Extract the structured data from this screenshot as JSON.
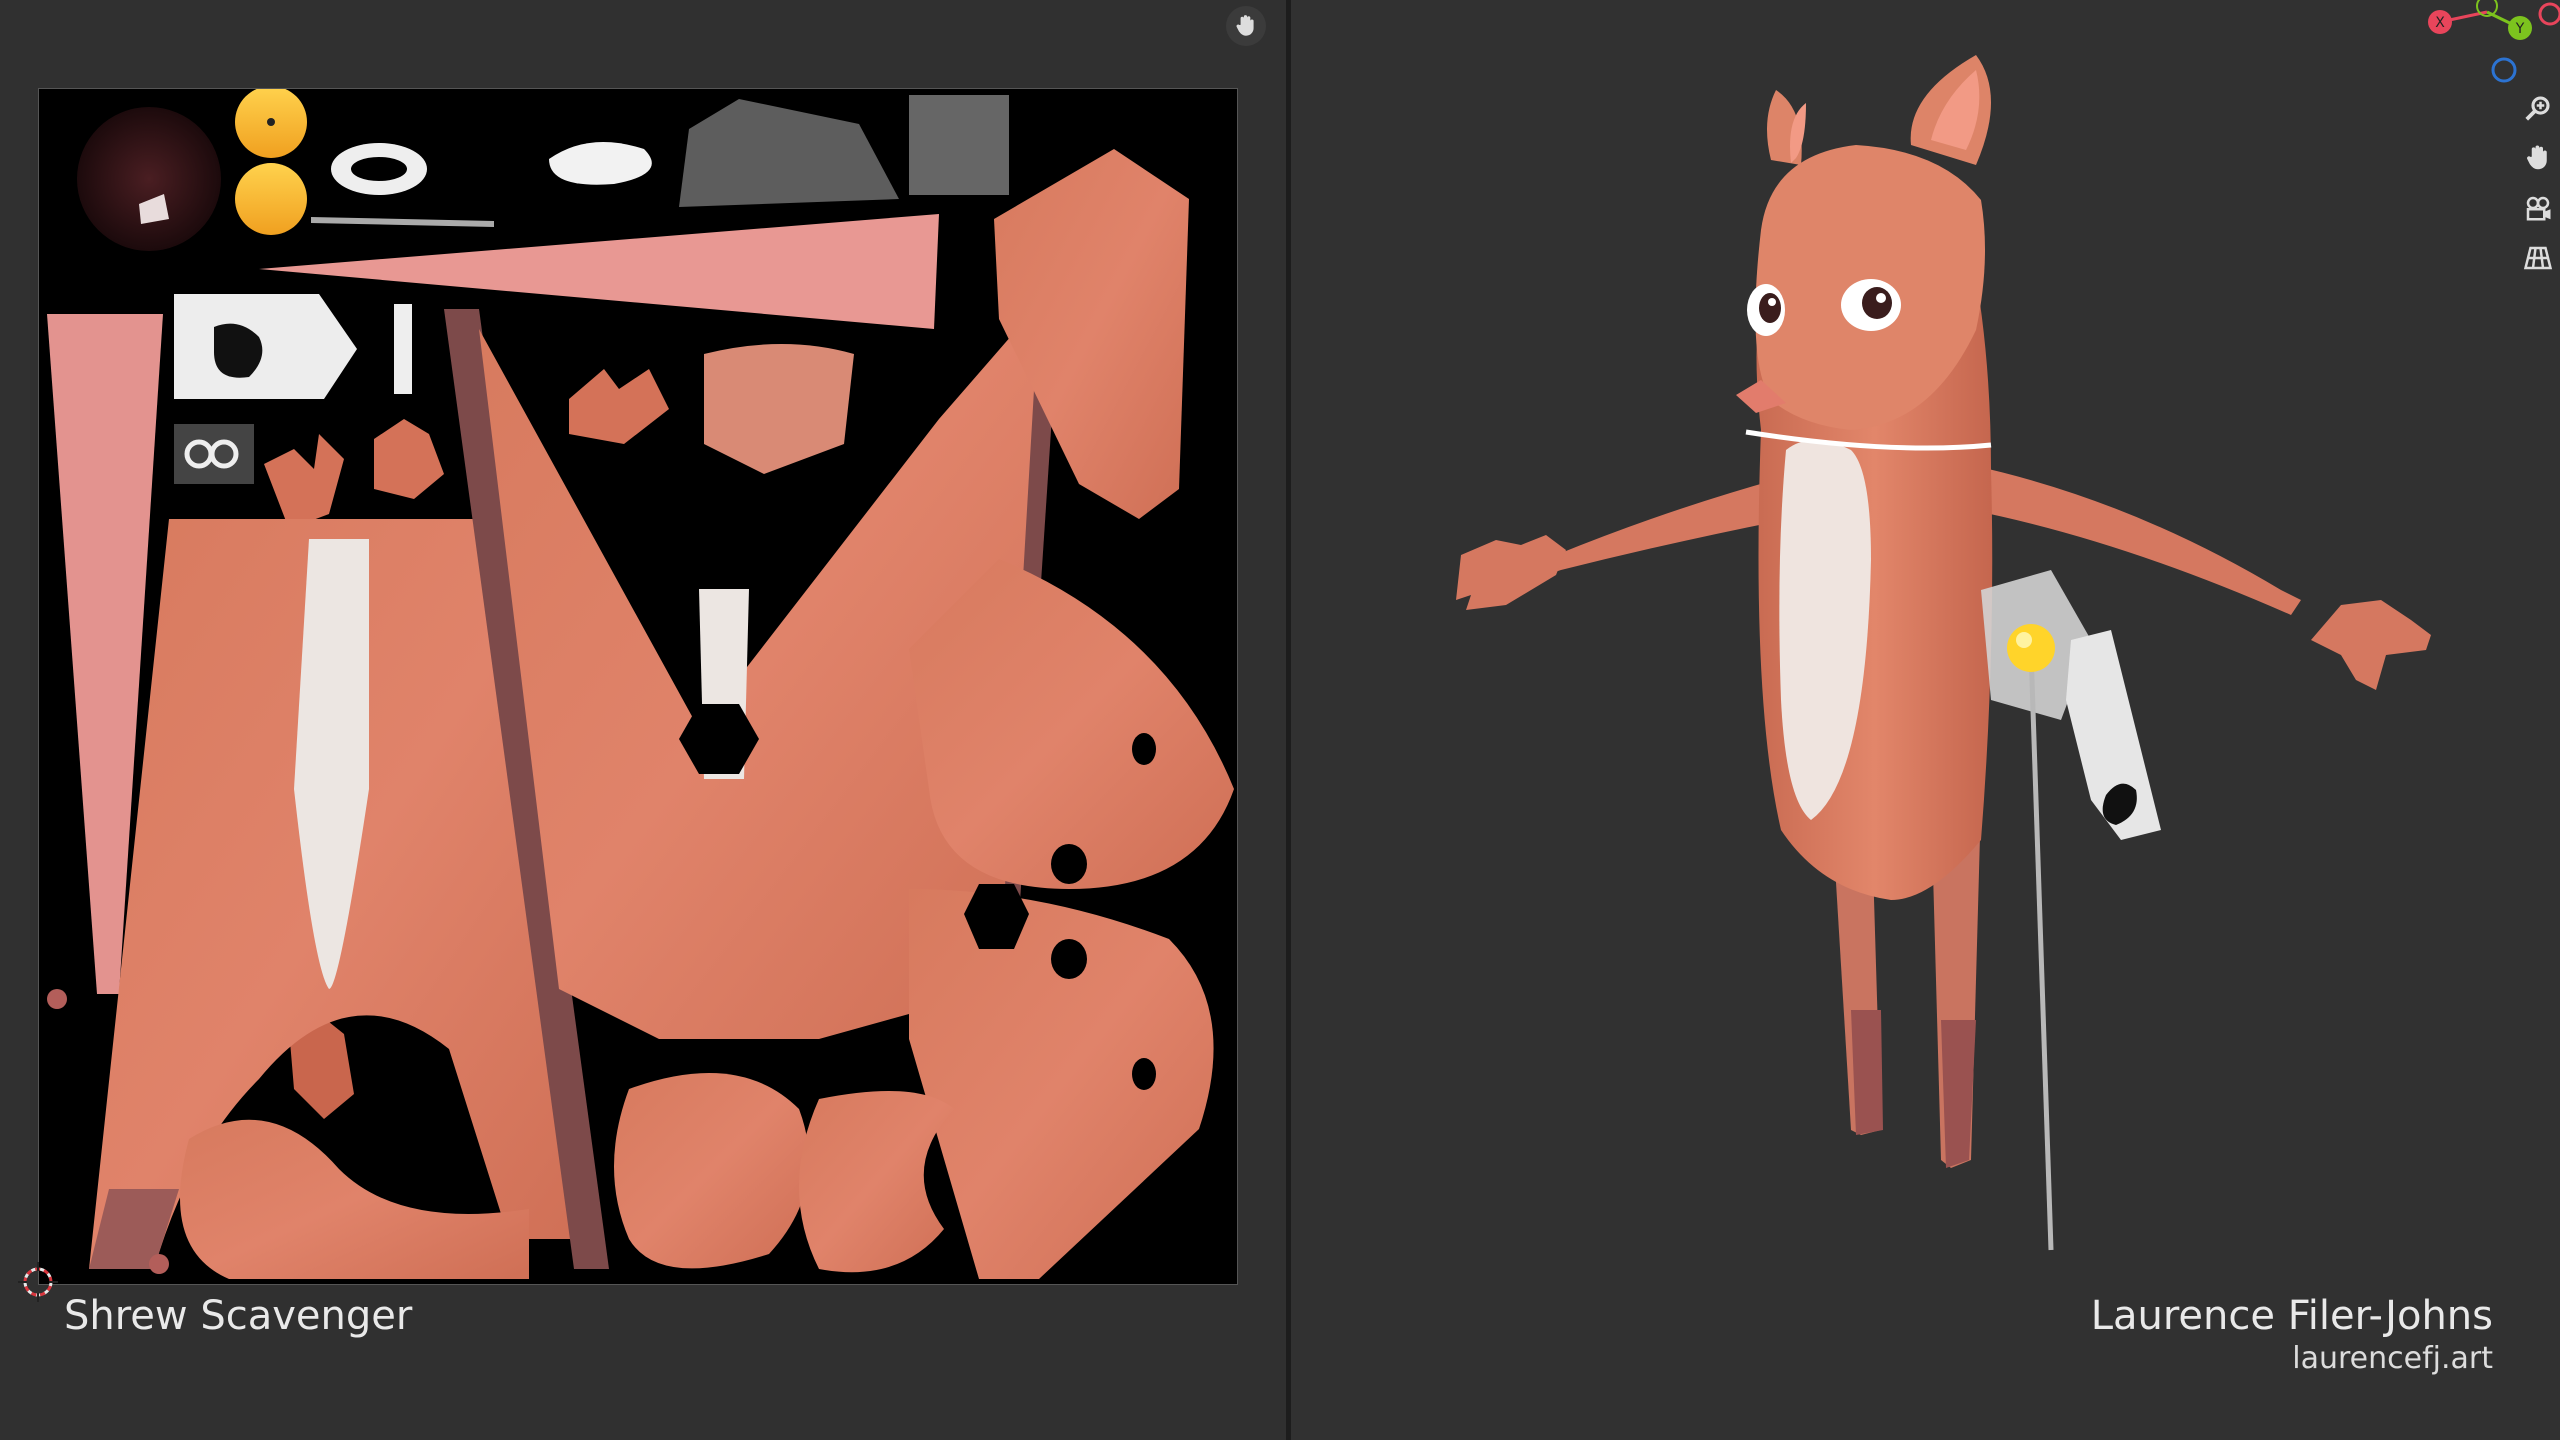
{
  "editors": {
    "uv": {
      "name": "uv-editor",
      "tool": "pan"
    },
    "viewport": {
      "name": "3d-viewport",
      "tool": "pan"
    }
  },
  "project": {
    "title": "Shrew Scavenger"
  },
  "credits": {
    "author": "Laurence Filer-Johns",
    "website": "laurencefj.art"
  },
  "gizmo": {
    "x_label": "X",
    "y_label": "Y",
    "x_color": "#e8455b",
    "y_color": "#7cc31e",
    "z_color": "#2c73d2"
  },
  "nav_icons": [
    "zoom-icon",
    "pan-hand-icon",
    "camera-icon",
    "perspective-grid-icon"
  ],
  "colors": {
    "fur": "#dd7e62",
    "fur_dark": "#c9664d",
    "belly": "#ece6e2",
    "background": "#303030"
  }
}
